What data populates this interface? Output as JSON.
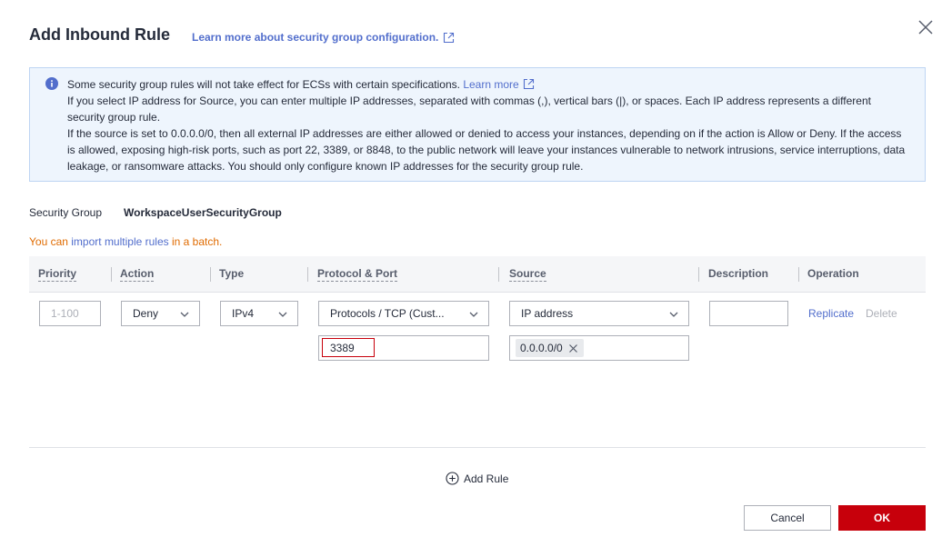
{
  "dialog": {
    "title": "Add Inbound Rule",
    "learn_more_link": "Learn more about security group configuration.",
    "close_icon": "close-icon"
  },
  "notice": {
    "icon": "info-icon",
    "line1": "Some security group rules will not take effect for ECSs with certain specifications. ",
    "line1_link": "Learn more",
    "line2": "If you select IP address for Source, you can enter multiple IP addresses, separated with commas (,), vertical bars (|), or spaces. Each IP address represents a different security group rule.",
    "line3": "If the source is set to 0.0.0.0/0, then all external IP addresses are either allowed or denied to access your instances, depending on if the action is Allow or Deny. If the access is allowed, exposing high-risk ports, such as port 22, 3389, or 8848, to the public network will leave your instances vulnerable to network intrusions, service interruptions, data leakage, or ransomware attacks. You should only configure known IP addresses for the security group rule."
  },
  "security_group": {
    "label": "Security Group",
    "value": "WorkspaceUserSecurityGroup"
  },
  "import_hint": {
    "prefix": "You can ",
    "link": "import multiple rules",
    "suffix": " in a batch."
  },
  "table": {
    "headers": {
      "priority": "Priority",
      "action": "Action",
      "type": "Type",
      "protocol_port": "Protocol & Port",
      "source": "Source",
      "description": "Description",
      "operation": "Operation"
    },
    "row": {
      "priority_placeholder": "1-100",
      "action": "Deny",
      "type": "IPv4",
      "protocol": "Protocols / TCP (Cust...",
      "port": "3389",
      "source_type": "IP address",
      "source_value": "0.0.0.0/0",
      "description": "",
      "replicate": "Replicate",
      "delete": "Delete"
    }
  },
  "add_rule": "Add Rule",
  "footer": {
    "cancel": "Cancel",
    "ok": "OK"
  },
  "colors": {
    "primary_red": "#c7000b",
    "link_blue": "#526ecc",
    "notice_bg": "#eef5fd",
    "warning_orange": "#e06b00"
  }
}
